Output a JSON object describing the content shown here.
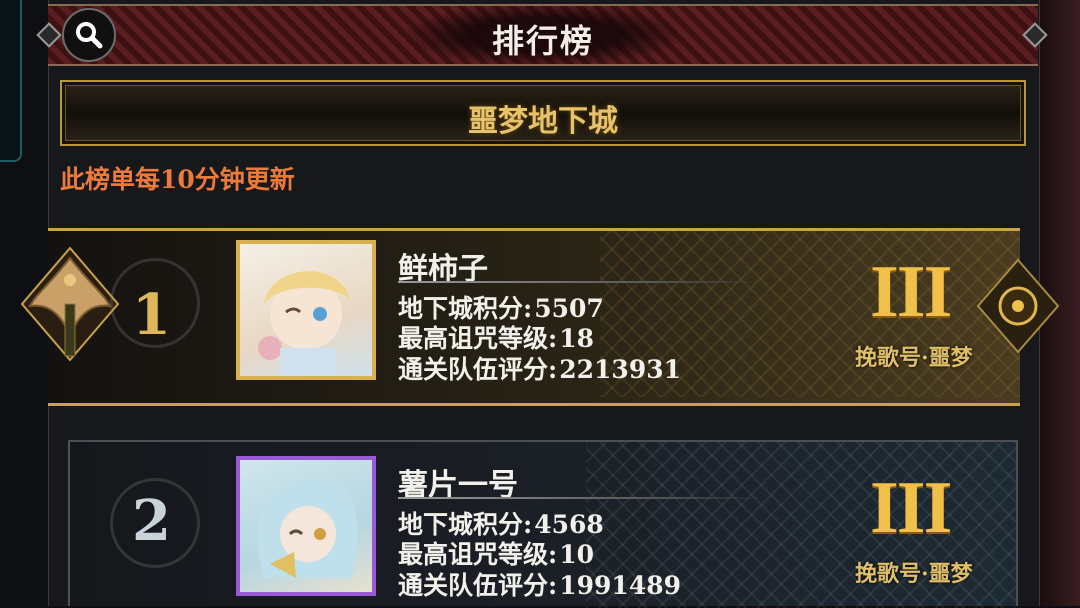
{
  "header": {
    "title": "排行榜",
    "search_icon": "search-icon"
  },
  "banner": {
    "label": "噩梦地下城"
  },
  "notice": "此榜单每10分钟更新",
  "entries": [
    {
      "rank": "1",
      "name": "鲜柿子",
      "stats": [
        {
          "label": "地下城积分:",
          "value": "5507"
        },
        {
          "label": "最高诅咒等级:",
          "value": "18"
        },
        {
          "label": "通关队伍评分:",
          "value": "2213931"
        }
      ],
      "tier": "III",
      "tier_label": "挽歌号·噩梦",
      "frame_color": "#d8b050"
    },
    {
      "rank": "2",
      "name": "薯片一号",
      "stats": [
        {
          "label": "地下城积分:",
          "value": "4568"
        },
        {
          "label": "最高诅咒等级:",
          "value": "10"
        },
        {
          "label": "通关队伍评分:",
          "value": "1991489"
        }
      ],
      "tier": "III",
      "tier_label": "挽歌号·噩梦",
      "frame_color": "#9a5ad8"
    }
  ],
  "colors": {
    "gold": "#e0b65a",
    "notice": "#ec7a3a",
    "title_bar": "#4a1a1c"
  }
}
